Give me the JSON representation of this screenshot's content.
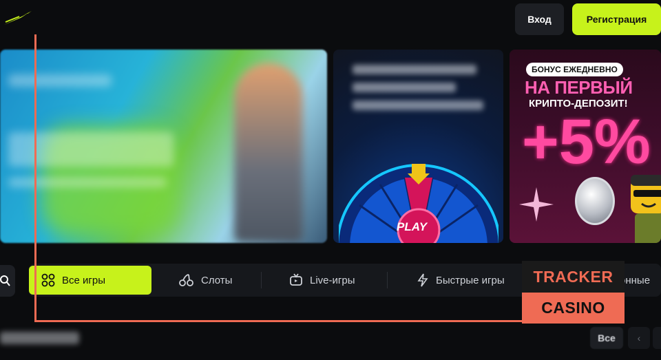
{
  "header": {
    "login_label": "Вход",
    "register_label": "Регистрация"
  },
  "promo": {
    "badge": "БОНУС ЕЖЕДНЕВНО",
    "headline": "НА ПЕРВЫЙ",
    "subline": "КРИПТО-ДЕПОЗИТ!",
    "big": "+5%",
    "play": "PLAY"
  },
  "tabs": [
    {
      "label": "Все игры",
      "icon": "grid-icon",
      "active": true
    },
    {
      "label": "Слоты",
      "icon": "cherries-icon",
      "active": false
    },
    {
      "label": "Live-игры",
      "icon": "tv-icon",
      "active": false
    },
    {
      "label": "Быстрые игры",
      "icon": "lightning-icon",
      "active": false
    },
    {
      "label": "онные",
      "icon": "",
      "active": false
    }
  ],
  "watermark": {
    "line1": "TRACKER",
    "line2": "CASINO"
  },
  "section": {
    "all_label": "Все",
    "prev": "‹",
    "next": "›"
  },
  "colors": {
    "accent": "#c7f21b",
    "watermark": "#ef6b54",
    "background": "#0b0c0e"
  }
}
